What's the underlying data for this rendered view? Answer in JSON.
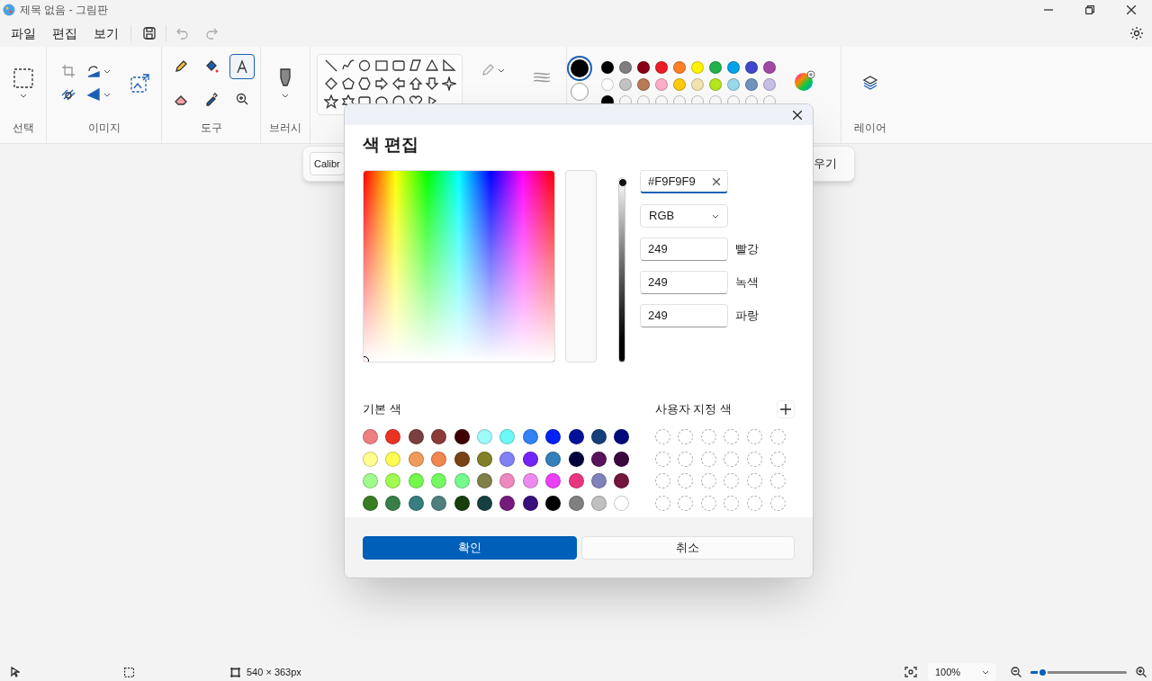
{
  "window": {
    "title": "제목 없음 - 그림판"
  },
  "menu": [
    {
      "label": "파일"
    },
    {
      "label": "편집"
    },
    {
      "label": "보기"
    }
  ],
  "quick_actions": [
    {
      "kind": "save",
      "disabled": false
    },
    {
      "kind": "undo",
      "disabled": true
    },
    {
      "kind": "redo",
      "disabled": true
    }
  ],
  "ribbon": {
    "groups": [
      {
        "label": "선택"
      },
      {
        "label": "이미지"
      },
      {
        "label": "도구"
      },
      {
        "label": "브러시"
      },
      {
        "label": "레이어"
      }
    ],
    "tools": [
      {
        "kind": "pencil",
        "selected": false
      },
      {
        "kind": "fill",
        "selected": false
      },
      {
        "kind": "text",
        "selected": true
      },
      {
        "kind": "eraser",
        "selected": false
      },
      {
        "kind": "picker",
        "selected": false
      },
      {
        "kind": "magnifier",
        "selected": false
      }
    ]
  },
  "palette": {
    "current": [
      {
        "color": "#000000",
        "selected": true
      },
      {
        "color": "#ffffff",
        "selected": false
      }
    ],
    "rows": [
      [
        {
          "color": "#000000"
        },
        {
          "color": "#7f7f7f"
        },
        {
          "color": "#880015"
        },
        {
          "color": "#ed1c24"
        },
        {
          "color": "#ff7f27"
        },
        {
          "color": "#fff200"
        },
        {
          "color": "#22b14c"
        },
        {
          "color": "#00a2e8"
        },
        {
          "color": "#3f48cc"
        },
        {
          "color": "#a349a4"
        }
      ],
      [
        {
          "color": "#ffffff"
        },
        {
          "color": "#c3c3c3"
        },
        {
          "color": "#b97a57"
        },
        {
          "color": "#ffaec9"
        },
        {
          "color": "#ffc90e"
        },
        {
          "color": "#efe4b0"
        },
        {
          "color": "#b5e61d"
        },
        {
          "color": "#99d9ea"
        },
        {
          "color": "#7092be"
        },
        {
          "color": "#c8bfe7"
        }
      ]
    ],
    "recent": [
      {
        "color": "#000000"
      }
    ]
  },
  "text_toolbar": {
    "font": "Calibr",
    "fragment": "우기"
  },
  "dialog": {
    "title": "색 편집",
    "preview": {
      "color": "#f9f9f9"
    },
    "brightness": {
      "level": 0.98
    },
    "hex": {
      "value": "#F9F9F9"
    },
    "mode": {
      "value": "RGB"
    },
    "channels": [
      {
        "value": "249",
        "label": "빨강"
      },
      {
        "value": "249",
        "label": "녹색"
      },
      {
        "value": "249",
        "label": "파랑"
      }
    ],
    "basic_colors": {
      "label": "기본 색",
      "colors": [
        {
          "color": "#f08080"
        },
        {
          "color": "#ea3323"
        },
        {
          "color": "#7a3f3f"
        },
        {
          "color": "#8b3a3a"
        },
        {
          "color": "#3f0000"
        },
        {
          "color": "#9ffafa"
        },
        {
          "color": "#6cf8f8"
        },
        {
          "color": "#3282f6"
        },
        {
          "color": "#0022f5"
        },
        {
          "color": "#00129a"
        },
        {
          "color": "#163e79"
        },
        {
          "color": "#000c7b"
        },
        {
          "color": "#fffe91"
        },
        {
          "color": "#fffd54"
        },
        {
          "color": "#f09b59"
        },
        {
          "color": "#f08650"
        },
        {
          "color": "#784315"
        },
        {
          "color": "#808026"
        },
        {
          "color": "#8080f7"
        },
        {
          "color": "#7524f6"
        },
        {
          "color": "#3580bb"
        },
        {
          "color": "#00023d"
        },
        {
          "color": "#58135e"
        },
        {
          "color": "#3a083e"
        },
        {
          "color": "#a0fc8d"
        },
        {
          "color": "#a1fb50"
        },
        {
          "color": "#75f94d"
        },
        {
          "color": "#75fa61"
        },
        {
          "color": "#75fa8d"
        },
        {
          "color": "#818049"
        },
        {
          "color": "#ef88be"
        },
        {
          "color": "#ee8aef"
        },
        {
          "color": "#ea3ff7"
        },
        {
          "color": "#ea3680"
        },
        {
          "color": "#7f82bb"
        },
        {
          "color": "#75163f"
        },
        {
          "color": "#377d22"
        },
        {
          "color": "#377e47"
        },
        {
          "color": "#367e7f"
        },
        {
          "color": "#507f80"
        },
        {
          "color": "#183e0c"
        },
        {
          "color": "#173f3f"
        },
        {
          "color": "#741b7c"
        },
        {
          "color": "#39107b"
        },
        {
          "color": "#000000"
        },
        {
          "color": "#808080"
        },
        {
          "color": "#c0c0c0"
        },
        {
          "color": "#ffffff"
        }
      ]
    },
    "custom_colors": {
      "label": "사용자 지정 색"
    },
    "buttons": [
      {
        "label": "확인",
        "kind": "primary"
      },
      {
        "label": "취소",
        "kind": "secondary"
      }
    ]
  },
  "status_bar": {
    "canvas_size": "540 × 363px",
    "zoom": "100%",
    "zoom_slider": {
      "level": 0.12
    }
  }
}
